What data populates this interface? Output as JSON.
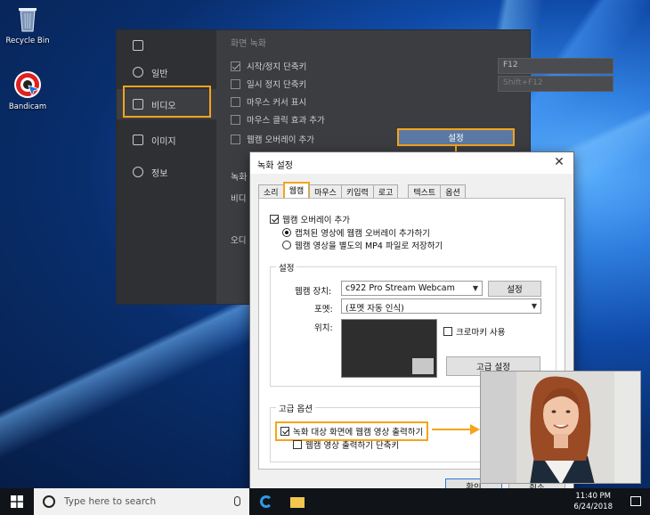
{
  "desktop": {
    "recycle_bin": "Recycle Bin",
    "bandicam": "Bandicam"
  },
  "bandicam": {
    "sidebar": [
      {
        "label": "",
        "icon": "home-icon"
      },
      {
        "label": "일반",
        "icon": "gear-icon"
      },
      {
        "label": "비디오",
        "icon": "video-icon"
      },
      {
        "label": "이미지",
        "icon": "image-icon"
      },
      {
        "label": "정보",
        "icon": "info-icon"
      }
    ],
    "section_title": "화면 녹화",
    "options": [
      {
        "label": "시작/정지 단축키",
        "checked": true,
        "value": "F12"
      },
      {
        "label": "일시 정지 단축키",
        "checked": false,
        "value": "Shift+F12"
      },
      {
        "label": "마우스 커서 표시",
        "checked": false
      },
      {
        "label": "마우스 클릭 효과 추가",
        "checked": false
      },
      {
        "label": "웹캠 오버레이 추가",
        "checked": false
      }
    ],
    "settings_button": "설정",
    "bottom_label1": "녹화",
    "bottom_label2": "비디",
    "bottom_label3": "오디"
  },
  "dialog": {
    "title": "녹화 설정",
    "close": "✕",
    "tabs": [
      "소리",
      "웹캠",
      "마우스",
      "키입력",
      "로고",
      "텍스트",
      "옵션"
    ],
    "active_tab": "웹캠",
    "webcam_overlay": {
      "label": "웹캠 오버레이 추가",
      "checked": true,
      "radio1": "캡쳐된 영상에 웹캠 오버레이 추가하기",
      "radio2": "웹캠 영상을 별도의 MP4 파일로 저장하기"
    },
    "settings_group": {
      "label": "설정",
      "device_label": "웹캠 장치:",
      "device_value": "c922 Pro Stream Webcam",
      "device_button": "설정",
      "format_label": "포멧:",
      "format_value": "(포멧 자동 인식)",
      "position_label": "위치:",
      "chroma_label": "크로마키 사용",
      "advanced_button": "고급 설정"
    },
    "advanced_group": {
      "label": "고급 옵션",
      "output_label": "녹화 대상 화면에 웹캠 영상 출력하기",
      "output_checked": true,
      "hotkey_label": "웹캠 영상 출력하기 단축키",
      "hotkey_checked": false
    },
    "ok_button": "확인",
    "cancel_button": "취소"
  },
  "taskbar": {
    "search_placeholder": "Type here to search",
    "time": "11:40 PM",
    "date": "6/24/2018"
  },
  "colors": {
    "highlight": "#f5a41b"
  }
}
